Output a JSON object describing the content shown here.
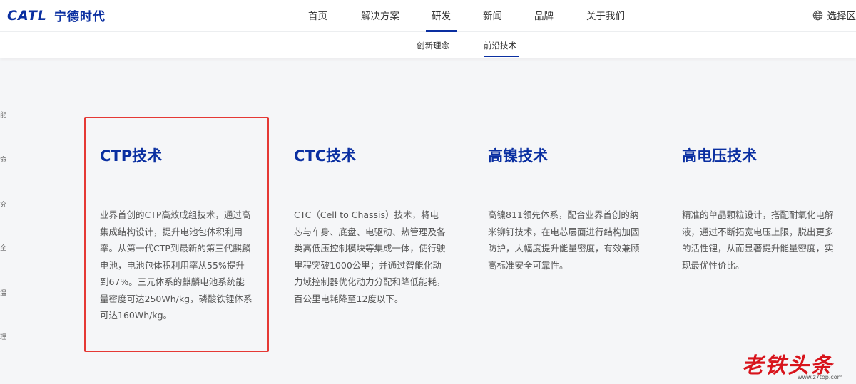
{
  "brand": {
    "logo_en": "CATL",
    "logo_cn": "宁德时代",
    "color": "#0a2fa1"
  },
  "nav": {
    "items": [
      {
        "label": "首页"
      },
      {
        "label": "解决方案"
      },
      {
        "label": "研发",
        "active": true
      },
      {
        "label": "新闻"
      },
      {
        "label": "品牌"
      },
      {
        "label": "关于我们"
      }
    ],
    "language_label": "选择区",
    "language_icon": "globe-icon"
  },
  "subnav": {
    "items": [
      {
        "label": "创新理念"
      },
      {
        "label": "前沿技术",
        "active": true
      }
    ]
  },
  "side_list": [
    "能",
    "命",
    "究",
    "全",
    "温",
    "理"
  ],
  "cards": [
    {
      "title": "CTP技术",
      "desc": "业界首创的CTP高效成组技术，通过高集成结构设计，提升电池包体积利用率。从第一代CTP到最新的第三代麒麟电池，电池包体积利用率从55%提升到67%。三元体系的麒麟电池系统能量密度可达250Wh/kg，磷酸铁锂体系可达160Wh/kg。",
      "highlighted": true
    },
    {
      "title": "CTC技术",
      "desc": "CTC（Cell to Chassis）技术，将电芯与车身、底盘、电驱动、热管理及各类高低压控制模块等集成一体，使行驶里程突破1000公里；并通过智能化动力域控制器优化动力分配和降低能耗，百公里电耗降至12度以下。"
    },
    {
      "title": "高镍技术",
      "desc": "高镍811领先体系，配合业界首创的纳米铆钉技术，在电芯层面进行结构加固防护，大幅度提升能量密度，有效兼顾高标准安全可靠性。"
    },
    {
      "title": "高电压技术",
      "desc": "精准的单晶颗粒设计，搭配耐氧化电解液，通过不断拓宽电压上限，脱出更多的活性锂，从而显著提升能量密度，实现最优性价比。"
    }
  ],
  "watermark": {
    "title": "老铁头条",
    "url": "www.z7top.com"
  },
  "highlight_color": "#e53935"
}
